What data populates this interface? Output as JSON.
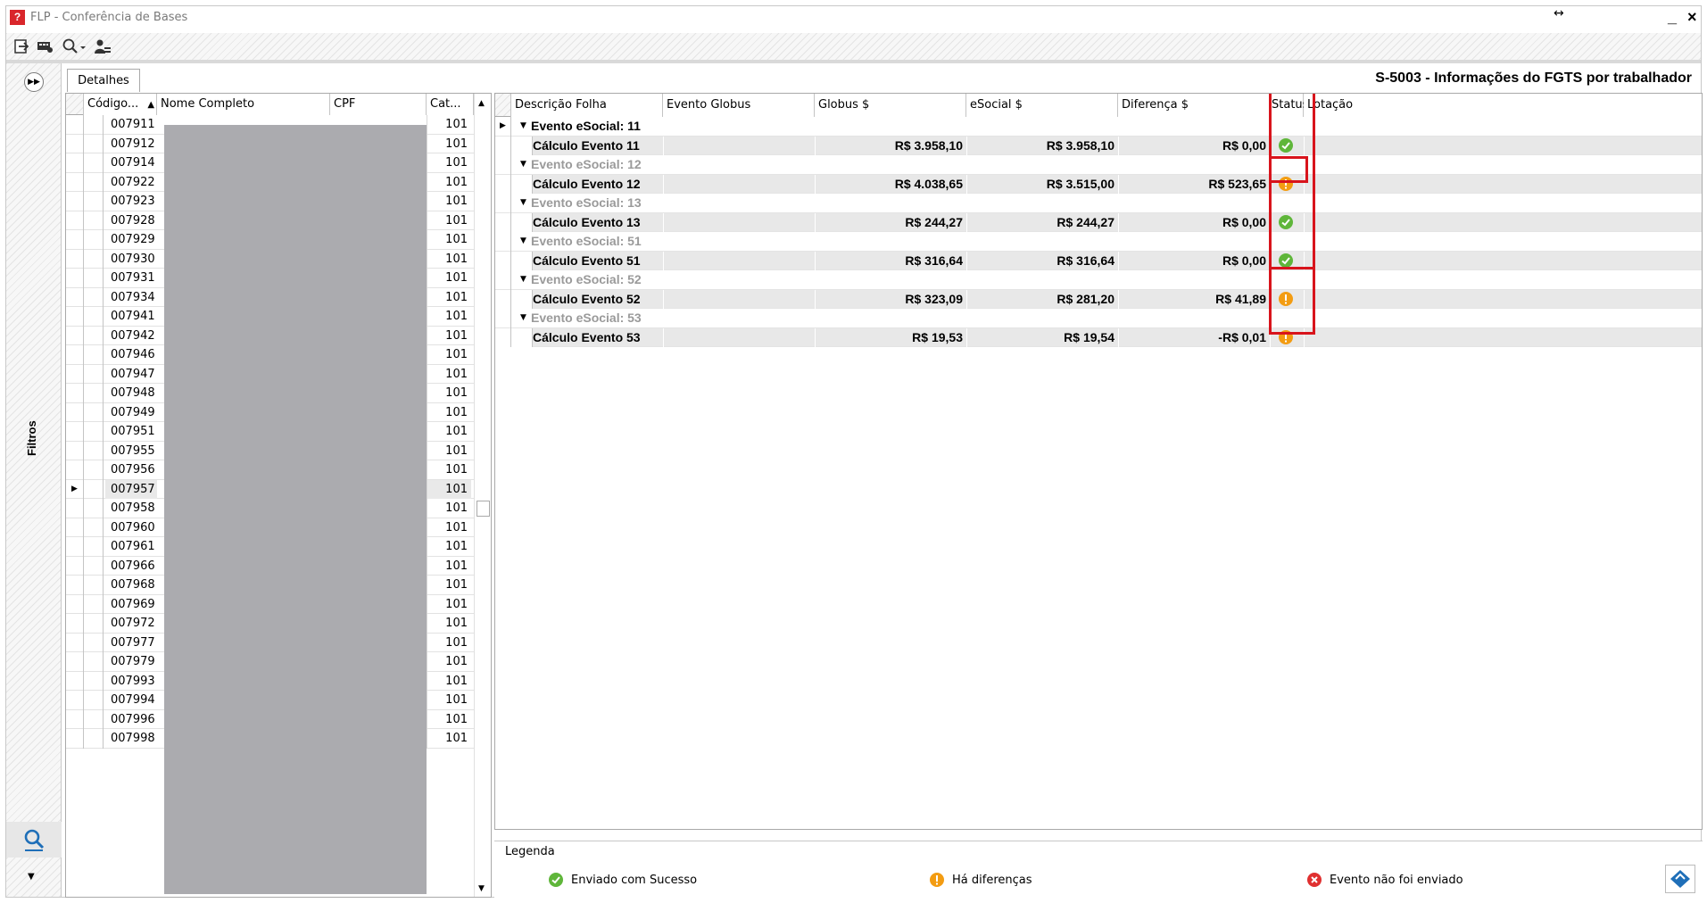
{
  "window": {
    "title": "FLP - Conferência de Bases"
  },
  "app_logo_glyph": "?",
  "titlebar": {
    "minimize_label": "_",
    "close_label": "×",
    "resize_icon": "↔"
  },
  "toolbar": {
    "buttons": [
      {
        "icon": "export-icon"
      },
      {
        "icon": "report-icon"
      },
      {
        "icon": "search-dropdown-icon"
      },
      {
        "icon": "user-config-icon"
      }
    ]
  },
  "side_panel": {
    "label": "Filtros",
    "expand_icon": "▶▶",
    "collapse_icon": "▼"
  },
  "tabs": [
    {
      "label": "Detalhes"
    }
  ],
  "page_heading": "S-5003 - Informações do FGTS por trabalhador",
  "employee_grid": {
    "columns": [
      "Código...",
      "Nome Completo",
      "CPF",
      "Cat..."
    ],
    "sort_indicator": "▲",
    "selected_index": 19,
    "rows": [
      {
        "codigo": "007911",
        "cat": "101"
      },
      {
        "codigo": "007912",
        "cat": "101"
      },
      {
        "codigo": "007914",
        "cat": "101"
      },
      {
        "codigo": "007922",
        "cat": "101"
      },
      {
        "codigo": "007923",
        "cat": "101"
      },
      {
        "codigo": "007928",
        "cat": "101"
      },
      {
        "codigo": "007929",
        "cat": "101"
      },
      {
        "codigo": "007930",
        "cat": "101"
      },
      {
        "codigo": "007931",
        "cat": "101"
      },
      {
        "codigo": "007934",
        "cat": "101"
      },
      {
        "codigo": "007941",
        "cat": "101"
      },
      {
        "codigo": "007942",
        "cat": "101"
      },
      {
        "codigo": "007946",
        "cat": "101"
      },
      {
        "codigo": "007947",
        "cat": "101"
      },
      {
        "codigo": "007948",
        "cat": "101"
      },
      {
        "codigo": "007949",
        "cat": "101"
      },
      {
        "codigo": "007951",
        "cat": "101"
      },
      {
        "codigo": "007955",
        "cat": "101"
      },
      {
        "codigo": "007956",
        "cat": "101"
      },
      {
        "codigo": "007957",
        "cat": "101"
      },
      {
        "codigo": "007958",
        "cat": "101"
      },
      {
        "codigo": "007960",
        "cat": "101"
      },
      {
        "codigo": "007961",
        "cat": "101"
      },
      {
        "codigo": "007966",
        "cat": "101"
      },
      {
        "codigo": "007968",
        "cat": "101"
      },
      {
        "codigo": "007969",
        "cat": "101"
      },
      {
        "codigo": "007972",
        "cat": "101"
      },
      {
        "codigo": "007977",
        "cat": "101"
      },
      {
        "codigo": "007979",
        "cat": "101"
      },
      {
        "codigo": "007993",
        "cat": "101"
      },
      {
        "codigo": "007994",
        "cat": "101"
      },
      {
        "codigo": "007996",
        "cat": "101"
      },
      {
        "codigo": "007998",
        "cat": "101"
      }
    ]
  },
  "events_grid": {
    "columns": [
      "Descrição Folha",
      "Evento Globus",
      "Globus $",
      "eSocial $",
      "Diferença $",
      "Status",
      "Lotação"
    ],
    "groups": [
      {
        "label": "Evento eSocial: 11",
        "dim": false,
        "detail": {
          "desc": "Cálculo Evento 11",
          "globus": "R$ 3.958,10",
          "esocial": "R$ 3.958,10",
          "diferenca": "R$ 0,00",
          "status": "ok"
        }
      },
      {
        "label": "Evento eSocial: 12",
        "dim": true,
        "detail": {
          "desc": "Cálculo Evento 12",
          "globus": "R$ 4.038,65",
          "esocial": "R$ 3.515,00",
          "diferenca": "R$ 523,65",
          "status": "warn"
        }
      },
      {
        "label": "Evento eSocial: 13",
        "dim": true,
        "detail": {
          "desc": "Cálculo Evento 13",
          "globus": "R$ 244,27",
          "esocial": "R$ 244,27",
          "diferenca": "R$ 0,00",
          "status": "ok"
        }
      },
      {
        "label": "Evento eSocial: 51",
        "dim": true,
        "detail": {
          "desc": "Cálculo Evento 51",
          "globus": "R$ 316,64",
          "esocial": "R$ 316,64",
          "diferenca": "R$ 0,00",
          "status": "ok"
        }
      },
      {
        "label": "Evento eSocial: 52",
        "dim": true,
        "detail": {
          "desc": "Cálculo Evento 52",
          "globus": "R$ 323,09",
          "esocial": "R$ 281,20",
          "diferenca": "R$ 41,89",
          "status": "warn"
        }
      },
      {
        "label": "Evento eSocial: 53",
        "dim": true,
        "detail": {
          "desc": "Cálculo Evento 53",
          "globus": "R$ 19,53",
          "esocial": "R$ 19,54",
          "diferenca": "-R$ 0,01",
          "status": "warn"
        }
      }
    ]
  },
  "legend": {
    "title": "Legenda",
    "items": [
      {
        "icon": "check-icon",
        "label": "Enviado com Sucesso"
      },
      {
        "icon": "warning-icon",
        "label": "Há diferenças"
      },
      {
        "icon": "error-icon",
        "label": "Evento não foi enviado"
      }
    ]
  },
  "colors": {
    "ok": "#5fb63a",
    "warn": "#f39c12",
    "error": "#e03030",
    "highlight": "#d8141c",
    "redacted": "#ababaf"
  }
}
